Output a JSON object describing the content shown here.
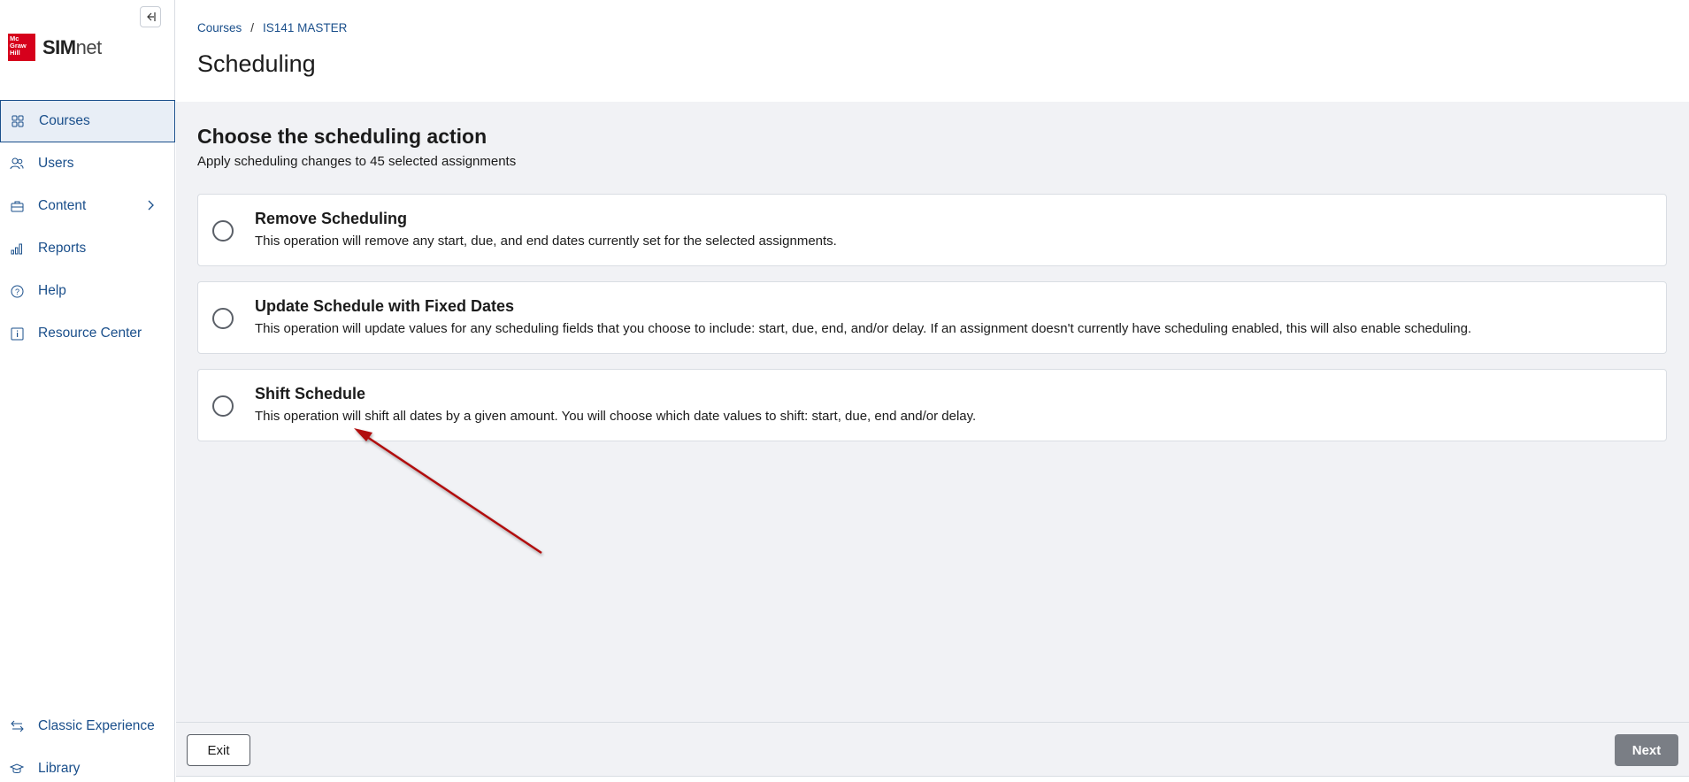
{
  "sidebar": {
    "collapse_icon": "collapse-left-icon",
    "logo": {
      "box_text": "Mc Graw Hill",
      "brand_bold": "SIM",
      "brand_light": "net"
    },
    "items": [
      {
        "label": "Courses",
        "icon": "grid-icon",
        "active": true
      },
      {
        "label": "Users",
        "icon": "users-icon"
      },
      {
        "label": "Content",
        "icon": "briefcase-icon",
        "has_chevron": true
      },
      {
        "label": "Reports",
        "icon": "bar-chart-icon"
      },
      {
        "label": "Help",
        "icon": "help-circle-icon"
      },
      {
        "label": "Resource Center",
        "icon": "info-icon"
      }
    ],
    "bottom_items": [
      {
        "label": "Classic Experience",
        "icon": "swap-arrows-icon"
      },
      {
        "label": "Library",
        "icon": "graduation-cap-icon"
      }
    ]
  },
  "header": {
    "breadcrumb": [
      "Courses",
      "IS141 MASTER"
    ],
    "breadcrumb_separator": "/",
    "title": "Scheduling"
  },
  "main": {
    "section_title": "Choose the scheduling action",
    "section_subtitle": "Apply scheduling changes to 45 selected assignments",
    "options": [
      {
        "title": "Remove Scheduling",
        "description": "This operation will remove any start, due, and end dates currently set for the selected assignments.",
        "selected": false
      },
      {
        "title": "Update Schedule with Fixed Dates",
        "description": "This operation will update values for any scheduling fields that you choose to include: start, due, end, and/or delay. If an assignment doesn't currently have scheduling enabled, this will also enable scheduling.",
        "selected": false
      },
      {
        "title": "Shift Schedule",
        "description": "This operation will shift all dates by a given amount. You will choose which date values to shift: start, due, end and/or delay.",
        "selected": false
      }
    ]
  },
  "footer": {
    "exit_label": "Exit",
    "next_label": "Next",
    "next_disabled": true
  },
  "colors": {
    "accent": "#1a4f8b",
    "brand_red": "#d6001c",
    "background": "#f1f2f5",
    "annotation_arrow": "#b10c0c"
  }
}
